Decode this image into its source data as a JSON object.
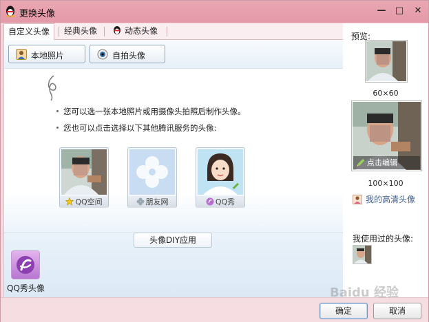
{
  "window": {
    "title": "更换头像",
    "controls": {
      "close": "✕",
      "maximize": "□",
      "minimize": "—"
    }
  },
  "tabs": [
    {
      "label": "自定义头像",
      "active": true
    },
    {
      "label": "经典头像",
      "active": false
    },
    {
      "label": "动态头像",
      "active": false
    }
  ],
  "toolbar": {
    "local_photo": "本地照片",
    "selfie": "自拍头像"
  },
  "hints": [
    "您可以选一张本地照片或用摄像头拍照后制作头像。",
    "您也可以点击选择以下其他腾讯服务的头像:"
  ],
  "services": [
    {
      "label": "QQ空间"
    },
    {
      "label": "朋友网"
    },
    {
      "label": "QQ秀"
    }
  ],
  "diy": {
    "button": "头像DIY应用",
    "app_label": "QQ秀头像"
  },
  "preview": {
    "title": "预览:",
    "small_label": "60×60",
    "large_label": "100×100",
    "edit": "点击编辑",
    "hd_link": "我的高清头像",
    "used_title": "我使用过的头像:"
  },
  "footer": {
    "ok": "确定",
    "cancel": "取消"
  },
  "watermark": "Baidu 经验",
  "colors": {
    "titlebar": "#e499a7",
    "window_bg": "#f6dde2",
    "content_bg": "#dce9f5",
    "link": "#3f5f8a"
  },
  "icons": {
    "app": "qq-penguin-icon",
    "local_photo": "person-photo-icon",
    "selfie": "webcam-icon",
    "edit": "pencil-icon",
    "hd": "person-avatar-icon"
  }
}
